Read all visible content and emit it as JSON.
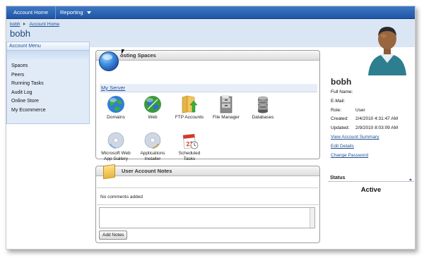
{
  "topnav": {
    "home_label": "Account Home",
    "reporting_label": "Reporting"
  },
  "breadcrumb": {
    "user": "bobh",
    "current": "Account Home"
  },
  "page": {
    "title": "bobh"
  },
  "menu": {
    "title": "Account Menu",
    "items": [
      "Spaces",
      "Peers",
      "Running Tasks",
      "Audit Log",
      "Online Store",
      "My Ecommerce"
    ]
  },
  "hosting": {
    "title": "Hosting Spaces",
    "title_visible": "osting Spaces",
    "server_link": "My Server",
    "tiles": [
      {
        "label": "Domains",
        "icon": "globe-icon"
      },
      {
        "label": "Web",
        "icon": "web-globe-icon"
      },
      {
        "label": "FTP Accounts",
        "icon": "folder-upload-icon"
      },
      {
        "label": "File Manager",
        "icon": "file-cabinet-icon"
      },
      {
        "label": "Databases",
        "icon": "database-icon"
      },
      {
        "label": "Microsoft Web\nApp Gallery",
        "label_l1": "Microsoft Web",
        "label_l2": "App Gallery",
        "icon": "disc-icon"
      },
      {
        "label_l1": "Applications",
        "label_l2": "Installer",
        "icon": "installer-disc-icon"
      },
      {
        "label_l1": "Scheduled",
        "label_l2": "Tasks",
        "icon": "calendar-icon"
      }
    ]
  },
  "notes": {
    "title": "User Account Notes",
    "empty_text": "No comments added",
    "add_button": "Add Notes"
  },
  "user": {
    "name": "bobh",
    "fields": [
      {
        "label": "Full Name:",
        "value": ""
      },
      {
        "label": "E-Mail:",
        "value": ""
      },
      {
        "label": "Role:",
        "value": "User"
      },
      {
        "label": "Created:",
        "value": "2/4/2010 4:31:47 AM"
      },
      {
        "label": "Updated:",
        "value": "2/9/2010 8:03:09 AM"
      }
    ],
    "links": [
      "View Account Summary",
      "Edit Details",
      "Change Password"
    ]
  },
  "status": {
    "label": "Status",
    "value": "Active"
  },
  "colors": {
    "nav": "#1f55a6",
    "header_bg": "#dbe6f4",
    "link": "#1f4f95",
    "menu_bg": "#e1ebf8"
  }
}
